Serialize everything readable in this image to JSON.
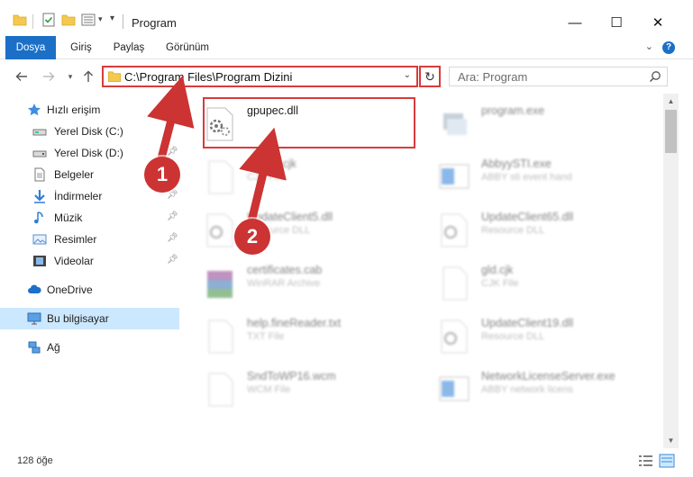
{
  "window": {
    "title": "Program",
    "minimize": "—",
    "maximize": "☐",
    "close": "✕"
  },
  "ribbon": {
    "tabs": [
      {
        "label": "Dosya",
        "active": true
      },
      {
        "label": "Giriş",
        "active": false
      },
      {
        "label": "Paylaş",
        "active": false
      },
      {
        "label": "Görünüm",
        "active": false
      }
    ],
    "help": "?"
  },
  "address": {
    "path": "C:\\Program Files\\Program Dizini",
    "refresh_icon": "↻"
  },
  "search": {
    "placeholder": "Ara: Program"
  },
  "nav": {
    "quick_access": "Hızlı erişim",
    "items": [
      {
        "label": "Yerel Disk (C:)",
        "icon": "drive-icon",
        "pinned": false
      },
      {
        "label": "Yerel Disk (D:)",
        "icon": "drive-icon",
        "pinned": false
      },
      {
        "label": "Belgeler",
        "icon": "documents-icon",
        "pinned": true
      },
      {
        "label": "İndirmeler",
        "icon": "downloads-icon",
        "pinned": true
      },
      {
        "label": "Müzik",
        "icon": "music-icon",
        "pinned": true
      },
      {
        "label": "Resimler",
        "icon": "pictures-icon",
        "pinned": true
      },
      {
        "label": "Videolar",
        "icon": "videos-icon",
        "pinned": true
      }
    ],
    "onedrive": "OneDrive",
    "this_pc": "Bu bilgisayar",
    "network": "Ağ"
  },
  "files": [
    {
      "name": "gpupec.dll",
      "type": "",
      "icon": "dll-icon",
      "highlighted": true
    },
    {
      "name": "program.exe",
      "type": "",
      "icon": "exe-icon",
      "highlighted": false
    },
    {
      "name": "Kanan.cjk",
      "type": "CJK File",
      "icon": "blank-file-icon",
      "highlighted": false
    },
    {
      "name": "AbbyySTI.exe",
      "type": "ABBY sti event hand",
      "icon": "window-app-icon",
      "highlighted": false
    },
    {
      "name": "UpdateClient5.dll",
      "type": "Resource DLL",
      "icon": "dll-icon",
      "highlighted": false
    },
    {
      "name": "UpdateClient65.dll",
      "type": "Resource DLL",
      "icon": "dll-icon",
      "highlighted": false
    },
    {
      "name": "certificates.cab",
      "type": "WinRAR Archive",
      "icon": "archive-icon",
      "highlighted": false
    },
    {
      "name": "gld.cjk",
      "type": "CJK File",
      "icon": "blank-file-icon",
      "highlighted": false
    },
    {
      "name": "help.fineReader.txt",
      "type": "TXT File",
      "icon": "blank-file-icon",
      "highlighted": false
    },
    {
      "name": "UpdateClient19.dll",
      "type": "Resource DLL",
      "icon": "dll-icon",
      "highlighted": false
    },
    {
      "name": "SndToWP16.wcm",
      "type": "WCM File",
      "icon": "blank-file-icon",
      "highlighted": false
    },
    {
      "name": "NetworkLicenseServer.exe",
      "type": "ABBY network licens",
      "icon": "window-app-icon",
      "highlighted": false
    }
  ],
  "status": {
    "count": "128 öğe"
  },
  "callouts": {
    "one": "1",
    "two": "2"
  },
  "colors": {
    "accent": "#1b6fc7",
    "callout": "#cc3333",
    "highlight_border": "#d83b3b",
    "selected_nav": "#cce8ff"
  }
}
